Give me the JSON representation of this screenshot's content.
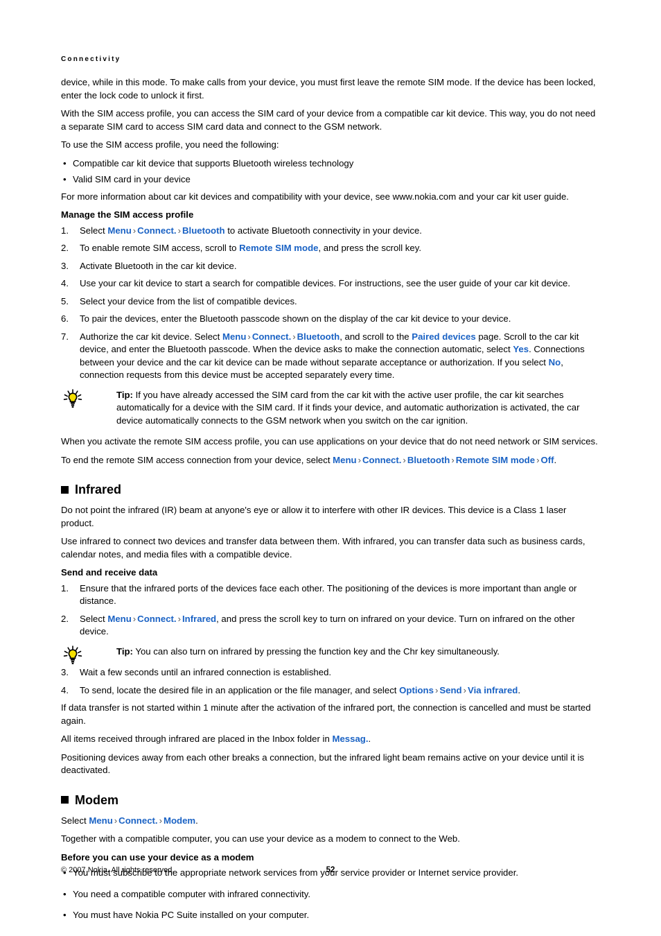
{
  "running_head": "Connectivity",
  "colors": {
    "link": "#1a62c4",
    "separator": "#5a5a5a",
    "text": "#000000",
    "bulb_yellow": "#f5e000",
    "background": "#ffffff"
  },
  "intro": {
    "para1": "device, while in this mode. To make calls from your device, you must first leave the remote SIM mode. If the device has been locked, enter the lock code to unlock it first.",
    "para2": "With the SIM access profile, you can access the SIM card of your device from a compatible car kit device. This way, you do not need a separate SIM card to access SIM card data and connect to the GSM network.",
    "para3": "To use the SIM access profile, you need the following:",
    "bullets": [
      "Compatible car kit device that supports Bluetooth wireless technology",
      "Valid SIM card in your device"
    ],
    "para4": "For more information about car kit devices and compatibility with your device, see www.nokia.com and your car kit user guide."
  },
  "manage_sim": {
    "heading": "Manage the SIM access profile",
    "step1": {
      "num": "1.",
      "pre": "Select ",
      "link1": "Menu",
      "sep1": "›",
      "link2": "Connect.",
      "sep2": "›",
      "link3": "Bluetooth",
      "post": " to activate Bluetooth connectivity in your device."
    },
    "step2": {
      "num": "2.",
      "pre": "To enable remote SIM access, scroll to ",
      "link1": "Remote SIM mode",
      "post": ", and press the scroll key."
    },
    "step3": {
      "num": "3.",
      "text": "Activate Bluetooth in the car kit device."
    },
    "step4": {
      "num": "4.",
      "text": "Use your car kit device to start a search for compatible devices. For instructions, see the user guide of your car kit device."
    },
    "step5": {
      "num": "5.",
      "text": "Select your device from the list of compatible devices."
    },
    "step6": {
      "num": "6.",
      "text": "To pair the devices, enter the Bluetooth passcode shown on the display of the car kit device to your device."
    },
    "step7": {
      "num": "7.",
      "pre": "Authorize the car kit device. Select ",
      "link1": "Menu",
      "sep1": "›",
      "link2": "Connect.",
      "sep2": "›",
      "link3": "Bluetooth",
      "mid1": ", and scroll to the ",
      "link4": "Paired devices",
      "mid2": " page. Scroll to the car kit device, and enter the Bluetooth passcode. When the device asks to make the connection automatic, select ",
      "link5": "Yes",
      "mid3": ". Connections between your device and the car kit device can be made without separate acceptance or authorization. If you select ",
      "link6": "No",
      "post": ", connection requests from this device must be accepted separately every time."
    }
  },
  "tip1": {
    "icon": "lightbulb-icon",
    "label": "Tip:",
    "text": " If you have already accessed the SIM card from the car kit with the active user profile, the car kit searches automatically for a device with the SIM card. If it finds your device, and automatic authorization is activated, the car device automatically connects to the GSM network when you switch on the car ignition."
  },
  "after_tip": {
    "para1": "When you activate the remote SIM access profile, you can use applications on your device that do not need network or SIM services.",
    "end_line": {
      "pre": "To end the remote SIM access connection from your device, select ",
      "link1": "Menu",
      "sep1": "›",
      "link2": "Connect.",
      "sep2": "›",
      "link3": "Bluetooth",
      "sep3": "›",
      "link4": "Remote SIM mode",
      "sep4": "›",
      "link5": "Off",
      "post": "."
    }
  },
  "infrared": {
    "heading": "Infrared",
    "para1": "Do not point the infrared (IR) beam at anyone's eye or allow it to interfere with other IR devices. This device is a Class 1 laser product.",
    "para2": "Use infrared to connect two devices and transfer data between them. With infrared, you can transfer data such as business cards, calendar notes, and media files with a compatible device.",
    "subheading": "Send and receive data",
    "step1": {
      "num": "1.",
      "text": "Ensure that the infrared ports of the devices face each other. The positioning of the devices is more important than angle or distance."
    },
    "step2": {
      "num": "2.",
      "pre": "Select ",
      "link1": "Menu",
      "sep1": "›",
      "link2": "Connect.",
      "sep2": "›",
      "link3": "Infrared",
      "post": ", and press the scroll key to turn on infrared on your device. Turn on infrared on the other device."
    },
    "tip2": {
      "icon": "lightbulb-icon",
      "label": "Tip:",
      "text": " You can also turn on infrared by pressing the function key and the Chr key simultaneously."
    },
    "step3": {
      "num": "3.",
      "text": "Wait a few seconds until an infrared connection is established."
    },
    "step4": {
      "num": "4.",
      "pre": "To send, locate the desired file in an application or the file manager, and select ",
      "link1": "Options",
      "sep1": "›",
      "link2": "Send",
      "sep2": "›",
      "link3": "Via infrared",
      "post": "."
    },
    "para3": "If data transfer is not started within 1 minute after the activation of the infrared port, the connection is cancelled and must be started again.",
    "para4_pre": "All items received through infrared are placed in the Inbox folder in ",
    "para4_link": "Messag.",
    "para4_post": ".",
    "para5": "Positioning devices away from each other breaks a connection, but the infrared light beam remains active on your device until it is deactivated."
  },
  "modem": {
    "heading": "Modem",
    "select_line": {
      "pre": "Select ",
      "link1": "Menu",
      "sep1": "›",
      "link2": "Connect.",
      "sep2": "›",
      "link3": "Modem",
      "post": "."
    },
    "para1": "Together with a compatible computer, you can use your device as a modem to connect to the Web.",
    "subheading": "Before you can use your device as a modem",
    "bullets": [
      "You must subscribe to the appropriate network services from your service provider or Internet service provider.",
      "You need a compatible computer with infrared connectivity.",
      "You must have Nokia PC Suite installed on your computer."
    ]
  },
  "footer": {
    "copyright": "© 2007 Nokia. All rights reserved.",
    "page_number": "52"
  },
  "bullet_glyph": "•"
}
